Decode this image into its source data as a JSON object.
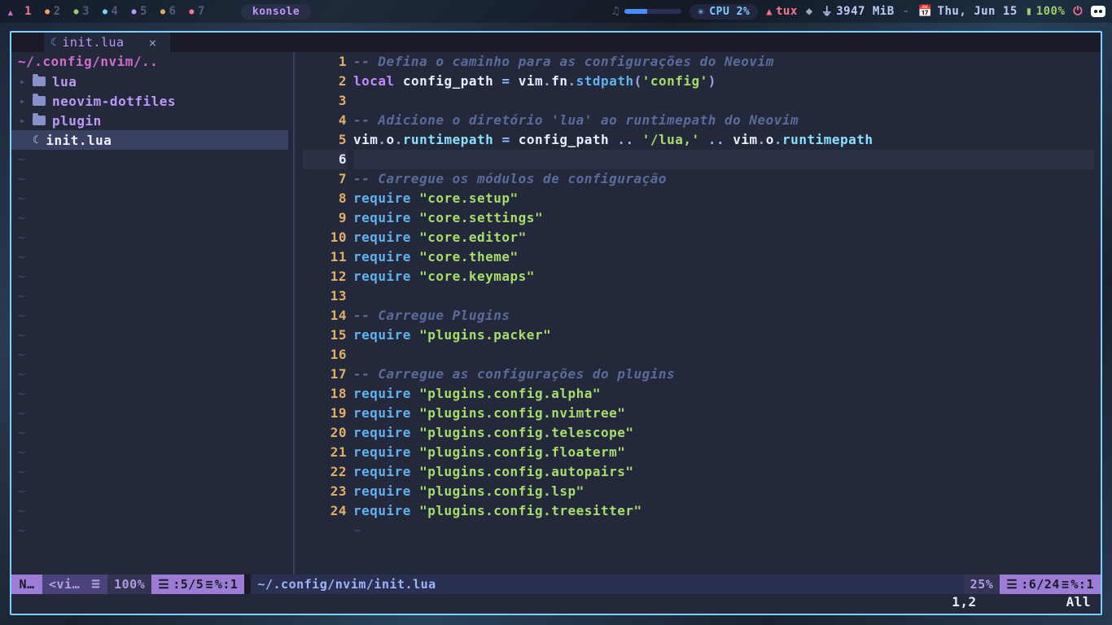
{
  "topbar": {
    "workspaces": [
      "1",
      "2",
      "3",
      "4",
      "5",
      "6",
      "7"
    ],
    "task_label": "konsole",
    "cpu_label": "CPU 2%",
    "user_label": "tux",
    "mem_label": "3947 MiB",
    "dash": "-",
    "date_label": "Thu, Jun 15",
    "battery_label": "100%"
  },
  "tab": {
    "filename": "init.lua",
    "close": "×"
  },
  "tree": {
    "root": "~/.config/nvim/..",
    "items": [
      {
        "kind": "folder",
        "label": "lua"
      },
      {
        "kind": "folder",
        "label": "neovim-dotfiles"
      },
      {
        "kind": "folder",
        "label": "plugin"
      },
      {
        "kind": "file",
        "label": "init.lua",
        "selected": true
      }
    ]
  },
  "status_left": {
    "mode": "N…",
    "vi": "<vi…",
    "pct": "100%",
    "pos_a": ":5/5",
    "pos_b": "%:1"
  },
  "status_right": {
    "path": "~/.config/nvim/init.lua",
    "pct": "25%",
    "pos_a": ":6/24",
    "pos_b": "%:1"
  },
  "ruler": {
    "pos": "1,2",
    "scroll": "All"
  },
  "code": {
    "lines": [
      {
        "n": "1",
        "tokens": [
          [
            "comment",
            "-- Defina o caminho para as configurações do Neovim"
          ]
        ]
      },
      {
        "n": "2",
        "tokens": [
          [
            "kw",
            "local"
          ],
          [
            "sp",
            " "
          ],
          [
            "ident",
            "config_path"
          ],
          [
            "sp",
            " "
          ],
          [
            "op",
            "="
          ],
          [
            "sp",
            " "
          ],
          [
            "ident",
            "vim"
          ],
          [
            "punc",
            "."
          ],
          [
            "ident",
            "fn"
          ],
          [
            "punc",
            "."
          ],
          [
            "call",
            "stdpath"
          ],
          [
            "punc",
            "("
          ],
          [
            "str",
            "'config'"
          ],
          [
            "punc",
            ")"
          ]
        ]
      },
      {
        "n": "3",
        "tokens": []
      },
      {
        "n": "4",
        "tokens": [
          [
            "comment",
            "-- Adicione o diretório 'lua' ao runtimepath do Neovim"
          ]
        ]
      },
      {
        "n": "5",
        "tokens": [
          [
            "ident",
            "vim"
          ],
          [
            "punc",
            "."
          ],
          [
            "ident",
            "o"
          ],
          [
            "punc",
            "."
          ],
          [
            "field",
            "runtimepath"
          ],
          [
            "sp",
            " "
          ],
          [
            "op",
            "="
          ],
          [
            "sp",
            " "
          ],
          [
            "ident",
            "config_path"
          ],
          [
            "sp",
            " "
          ],
          [
            "op",
            ".."
          ],
          [
            "sp",
            " "
          ],
          [
            "str",
            "'/lua,'"
          ],
          [
            "sp",
            " "
          ],
          [
            "op",
            ".."
          ],
          [
            "sp",
            " "
          ],
          [
            "ident",
            "vim"
          ],
          [
            "punc",
            "."
          ],
          [
            "ident",
            "o"
          ],
          [
            "punc",
            "."
          ],
          [
            "field",
            "runtimepath"
          ]
        ]
      },
      {
        "n": "6",
        "current": true,
        "tokens": []
      },
      {
        "n": "7",
        "tokens": [
          [
            "comment",
            "-- Carregue os módulos de configuração"
          ]
        ]
      },
      {
        "n": "8",
        "tokens": [
          [
            "call",
            "require"
          ],
          [
            "sp",
            " "
          ],
          [
            "str",
            "\"core.setup\""
          ]
        ]
      },
      {
        "n": "9",
        "tokens": [
          [
            "call",
            "require"
          ],
          [
            "sp",
            " "
          ],
          [
            "str",
            "\"core.settings\""
          ]
        ]
      },
      {
        "n": "10",
        "tokens": [
          [
            "call",
            "require"
          ],
          [
            "sp",
            " "
          ],
          [
            "str",
            "\"core.editor\""
          ]
        ]
      },
      {
        "n": "11",
        "tokens": [
          [
            "call",
            "require"
          ],
          [
            "sp",
            " "
          ],
          [
            "str",
            "\"core.theme\""
          ]
        ]
      },
      {
        "n": "12",
        "tokens": [
          [
            "call",
            "require"
          ],
          [
            "sp",
            " "
          ],
          [
            "str",
            "\"core.keymaps\""
          ]
        ]
      },
      {
        "n": "13",
        "tokens": []
      },
      {
        "n": "14",
        "tokens": [
          [
            "comment",
            "-- Carregue Plugins"
          ]
        ]
      },
      {
        "n": "15",
        "tokens": [
          [
            "call",
            "require"
          ],
          [
            "sp",
            " "
          ],
          [
            "str",
            "\"plugins.packer\""
          ]
        ]
      },
      {
        "n": "16",
        "tokens": []
      },
      {
        "n": "17",
        "tokens": [
          [
            "comment",
            "-- Carregue as configurações do plugins"
          ]
        ]
      },
      {
        "n": "18",
        "tokens": [
          [
            "call",
            "require"
          ],
          [
            "sp",
            " "
          ],
          [
            "str",
            "\"plugins.config.alpha\""
          ]
        ]
      },
      {
        "n": "19",
        "tokens": [
          [
            "call",
            "require"
          ],
          [
            "sp",
            " "
          ],
          [
            "str",
            "\"plugins.config.nvimtree\""
          ]
        ]
      },
      {
        "n": "20",
        "tokens": [
          [
            "call",
            "require"
          ],
          [
            "sp",
            " "
          ],
          [
            "str",
            "\"plugins.config.telescope\""
          ]
        ]
      },
      {
        "n": "21",
        "tokens": [
          [
            "call",
            "require"
          ],
          [
            "sp",
            " "
          ],
          [
            "str",
            "\"plugins.config.floaterm\""
          ]
        ]
      },
      {
        "n": "22",
        "tokens": [
          [
            "call",
            "require"
          ],
          [
            "sp",
            " "
          ],
          [
            "str",
            "\"plugins.config.autopairs\""
          ]
        ]
      },
      {
        "n": "23",
        "tokens": [
          [
            "call",
            "require"
          ],
          [
            "sp",
            " "
          ],
          [
            "str",
            "\"plugins.config.lsp\""
          ]
        ]
      },
      {
        "n": "24",
        "tokens": [
          [
            "call",
            "require"
          ],
          [
            "sp",
            " "
          ],
          [
            "str",
            "\"plugins.config.treesitter\""
          ]
        ]
      }
    ]
  }
}
